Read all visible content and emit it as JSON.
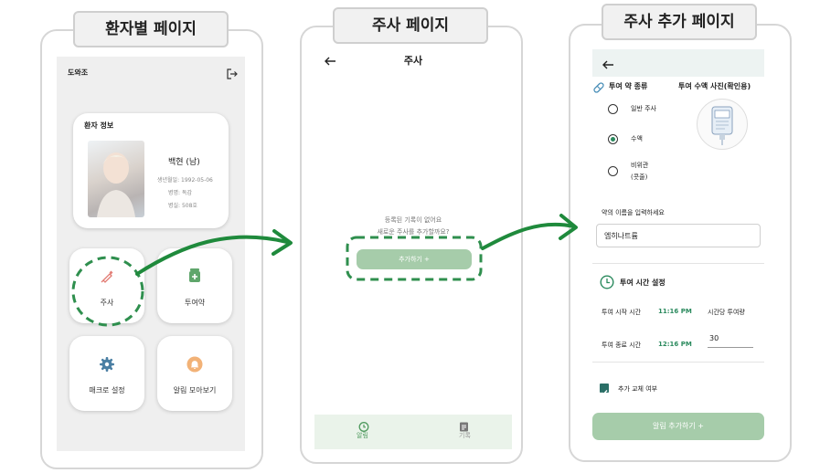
{
  "colors": {
    "accent": "#2b8a5e",
    "button": "#a6ccaa",
    "arrow": "#1f8a3c"
  },
  "panel1": {
    "tag": "환자별 페이지",
    "app_title": "도와조",
    "logout_icon": "logout-icon",
    "patient_card": {
      "title": "환자 정보",
      "name": "백현 (남)",
      "birth": "생년월일: 1992-05-06",
      "disease": "병명: 독감",
      "room": "병실: 508호"
    },
    "tiles": [
      {
        "label": "주사",
        "icon": "syringe-icon"
      },
      {
        "label": "투여약",
        "icon": "medicine-icon"
      },
      {
        "label": "매크로 설정",
        "icon": "gear-icon"
      },
      {
        "label": "알림 모아보기",
        "icon": "bell-icon"
      }
    ]
  },
  "panel2": {
    "tag": "주사 페이지",
    "title": "주사",
    "empty_line1": "등록된 기록이 없어요",
    "empty_line2": "새로운 주사를 추가할까요?",
    "add_button": "추가하기 +",
    "nav": [
      {
        "label": "알림",
        "icon": "clock-icon"
      },
      {
        "label": "기록",
        "icon": "clipboard-icon"
      }
    ]
  },
  "panel3": {
    "tag": "주사 추가 페이지",
    "drug_type_label": "투여 약 종류",
    "photo_label": "투여 수액 사진(확인용)",
    "options": [
      {
        "label": "일반 주사",
        "selected": false
      },
      {
        "label": "수액",
        "selected": true
      },
      {
        "label_line1": "비위관",
        "label_line2": "(콧줄)",
        "selected": false
      }
    ],
    "name_prompt": "약의 이름을 입력하세요",
    "name_value": "엠히나트륨",
    "time_section_title": "투여 시간 설정",
    "start_label": "투여 시작 시간",
    "start_time": "11:16 PM",
    "end_label": "투여 종료 시간",
    "end_time": "12:16 PM",
    "rate_label": "시간당 투여량",
    "rate_value": "30",
    "replace_label": "추가 교체 여부",
    "replace_checked": true,
    "submit_button": "알림 추가하기 +"
  }
}
